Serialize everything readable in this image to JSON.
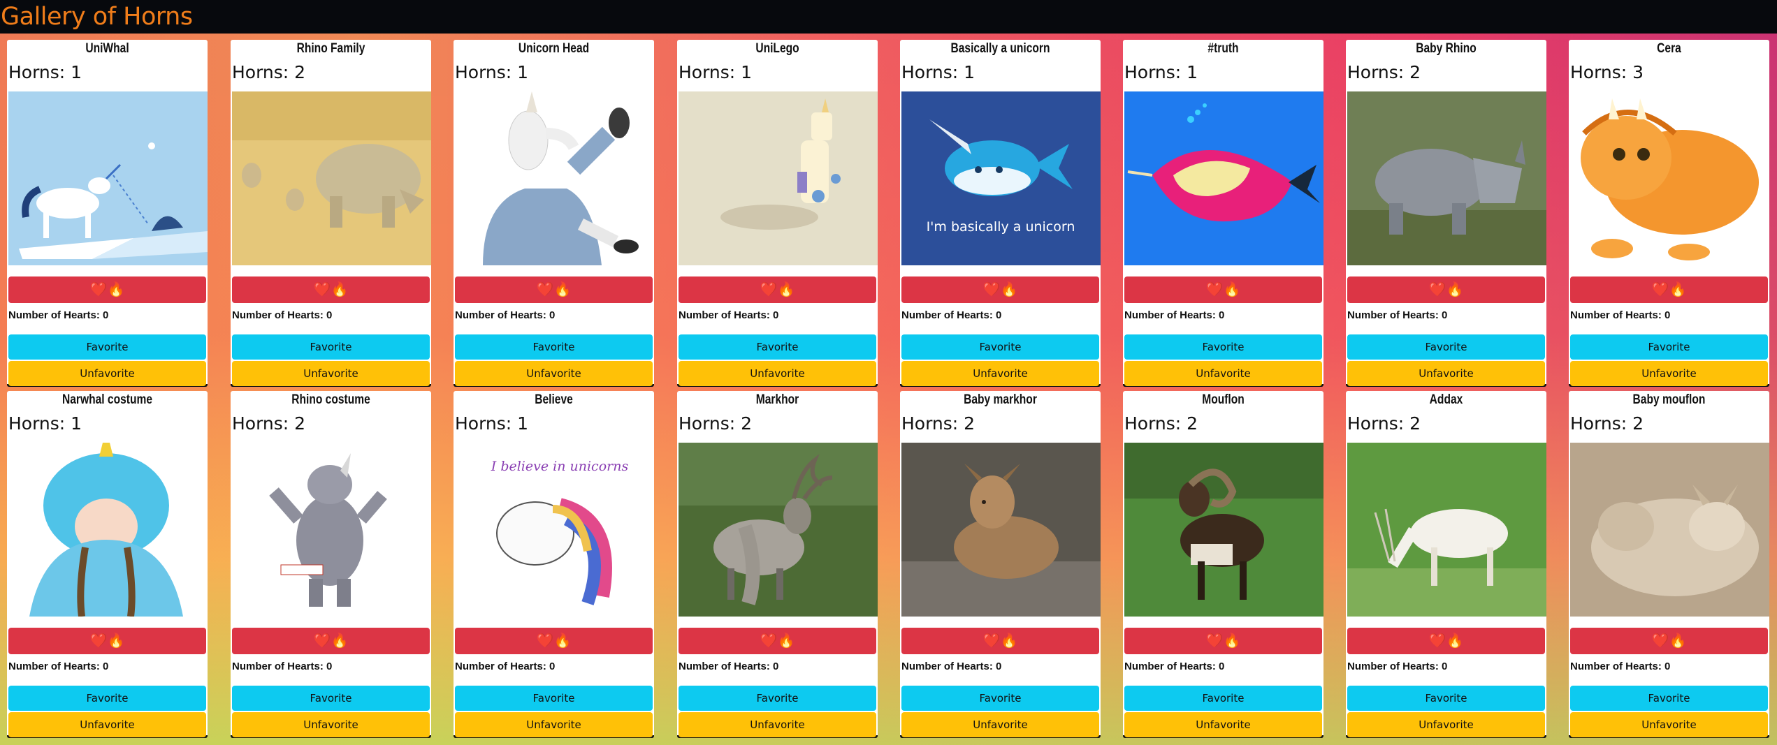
{
  "app": {
    "title": "Gallery of Horns"
  },
  "colors": {
    "header_bg": "#07090d",
    "title": "#f07d1a",
    "heart_button": "#dc3545",
    "favorite_button": "#0dcaf0",
    "unfavorite_button": "#ffc107"
  },
  "labels": {
    "heart_icons": "❤️🔥",
    "hearts_prefix": "Number of Hearts: 0",
    "favorite": "Favorite",
    "unfavorite": "Unfavorite"
  },
  "beasts": [
    {
      "title": "UniWhal",
      "horns": "Horns: 1",
      "image": "unicorn-narwhal-illustration"
    },
    {
      "title": "Rhino Family",
      "horns": "Horns: 2",
      "image": "rhino-family-photo"
    },
    {
      "title": "Unicorn Head",
      "horns": "Horns: 1",
      "image": "unicorn-mask-photo"
    },
    {
      "title": "UniLego",
      "horns": "Horns: 1",
      "image": "lego-unicorn-photo"
    },
    {
      "title": "Basically a unicorn",
      "horns": "Horns: 1",
      "image": "narwhal-cartoon",
      "image_text": "I'm basically a unicorn"
    },
    {
      "title": "#truth",
      "horns": "Horns: 1",
      "image": "narwhal-unicorn-tshirt-art"
    },
    {
      "title": "Baby Rhino",
      "horns": "Horns: 2",
      "image": "baby-rhino-photo"
    },
    {
      "title": "Cera",
      "horns": "Horns: 3",
      "image": "triceratops-cartoon"
    },
    {
      "title": "Narwhal costume",
      "horns": "Horns: 1",
      "image": "narwhal-costume-photo"
    },
    {
      "title": "Rhino costume",
      "horns": "Horns: 2",
      "image": "rhino-costume-photo"
    },
    {
      "title": "Believe",
      "horns": "Horns: 1",
      "image": "believe-unicorn-art",
      "image_text": "I believe in unicorns"
    },
    {
      "title": "Markhor",
      "horns": "Horns: 2",
      "image": "markhor-photo"
    },
    {
      "title": "Baby markhor",
      "horns": "Horns: 2",
      "image": "baby-markhor-photo"
    },
    {
      "title": "Mouflon",
      "horns": "Horns: 2",
      "image": "mouflon-photo"
    },
    {
      "title": "Addax",
      "horns": "Horns: 2",
      "image": "addax-photo"
    },
    {
      "title": "Baby mouflon",
      "horns": "Horns: 2",
      "image": "baby-mouflon-photo"
    }
  ]
}
